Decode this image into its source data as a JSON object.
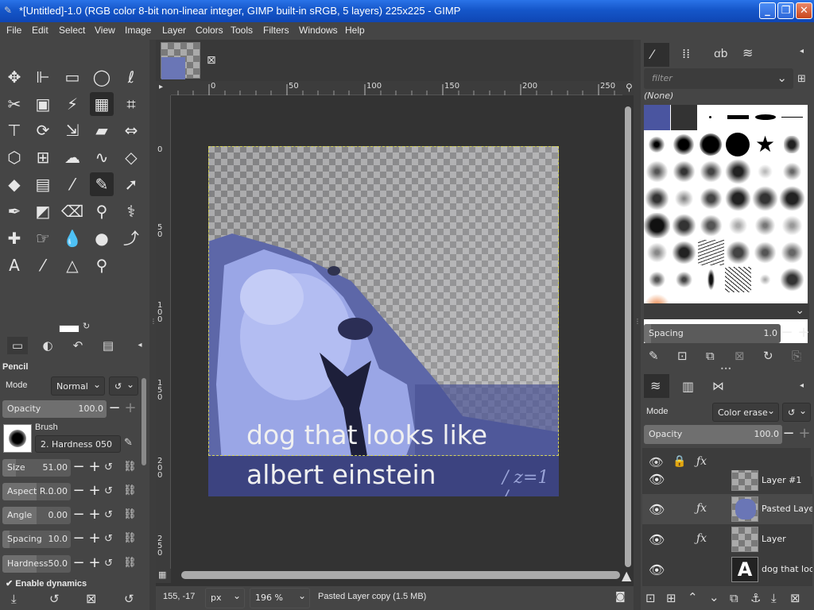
{
  "window": {
    "title": "*[Untitled]-1.0 (RGB color 8-bit non-linear integer, GIMP built-in sRGB, 5 layers) 225x225 - GIMP"
  },
  "menu": [
    "File",
    "Edit",
    "Select",
    "View",
    "Image",
    "Layer",
    "Colors",
    "Tools",
    "Filters",
    "Windows",
    "Help"
  ],
  "tool_options": {
    "title": "Pencil",
    "mode_label": "Mode",
    "mode_value": "Normal",
    "opacity_label": "Opacity",
    "opacity_value": "100.0",
    "brush_label": "Brush",
    "brush_value": "2. Hardness 050",
    "size_label": "Size",
    "size_value": "51.00",
    "aspect_label": "Aspect R...",
    "aspect_value": "0.00",
    "angle_label": "Angle",
    "angle_value": "0.00",
    "spacing_label": "Spacing",
    "spacing_value": "10.0",
    "hardness_label": "Hardness",
    "hardness_value": "50.0",
    "dynamics_label": "Enable dynamics"
  },
  "ruler": {
    "top": [
      "0",
      "50",
      "100",
      "150",
      "200",
      "250"
    ],
    "left": [
      "0",
      "5\n0",
      "1\n0\n0",
      "1\n5\n0",
      "2\n0\n0",
      "2\n5\n0"
    ]
  },
  "image_caption": {
    "line1": "dog that looks like",
    "line2": "albert einstein",
    "chalk": "/ z=1 /"
  },
  "status": {
    "coords": "155, -17",
    "unit": "px",
    "zoom": "196 %",
    "message": "Pasted Layer copy (1.5 MB)"
  },
  "brushes": {
    "filter_placeholder": "filter",
    "current": "(None)",
    "spacing_label": "Spacing",
    "spacing_value": "1.0"
  },
  "layers": {
    "mode_label": "Mode",
    "mode_value": "Color erase",
    "opacity_label": "Opacity",
    "opacity_value": "100.0",
    "items": [
      {
        "name": "Layer #1"
      },
      {
        "name": "Pasted Layer"
      },
      {
        "name": "Layer"
      },
      {
        "name": "dog that look"
      }
    ]
  },
  "colors": {
    "accent_titlebar": "#1556c9",
    "bg_panel": "#454545",
    "foreground": "#ffffff",
    "background": "#000000"
  }
}
